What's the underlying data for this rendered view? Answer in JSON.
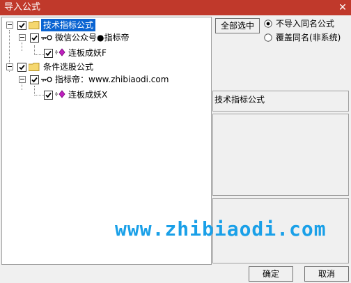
{
  "window": {
    "title": "导入公式"
  },
  "tree": {
    "groups": [
      {
        "label": "技术指标公式",
        "checked": true,
        "selected": true,
        "author": {
          "label": "微信公众号●指标帝",
          "checked": true,
          "formula": {
            "label": "连板成妖F",
            "checked": true
          }
        }
      },
      {
        "label": "条件选股公式",
        "checked": true,
        "selected": false,
        "author": {
          "label": "指标帝：www.zhibiaodi.com",
          "checked": true,
          "formula": {
            "label": "连板成妖X",
            "checked": true
          }
        }
      }
    ]
  },
  "options": {
    "select_all_label": "全部选中",
    "radio_no_import": "不导入同名公式",
    "radio_overwrite": "覆盖同名(非系统)",
    "selected_radio": "no_import"
  },
  "detail": {
    "category_label": "技术指标公式"
  },
  "buttons": {
    "ok": "确定",
    "cancel": "取消"
  },
  "watermark": "www.zhibiaodi.com",
  "colors": {
    "titlebar": "#c0392b",
    "selection": "#0a64d2",
    "watermark": "#1aa0e8"
  }
}
